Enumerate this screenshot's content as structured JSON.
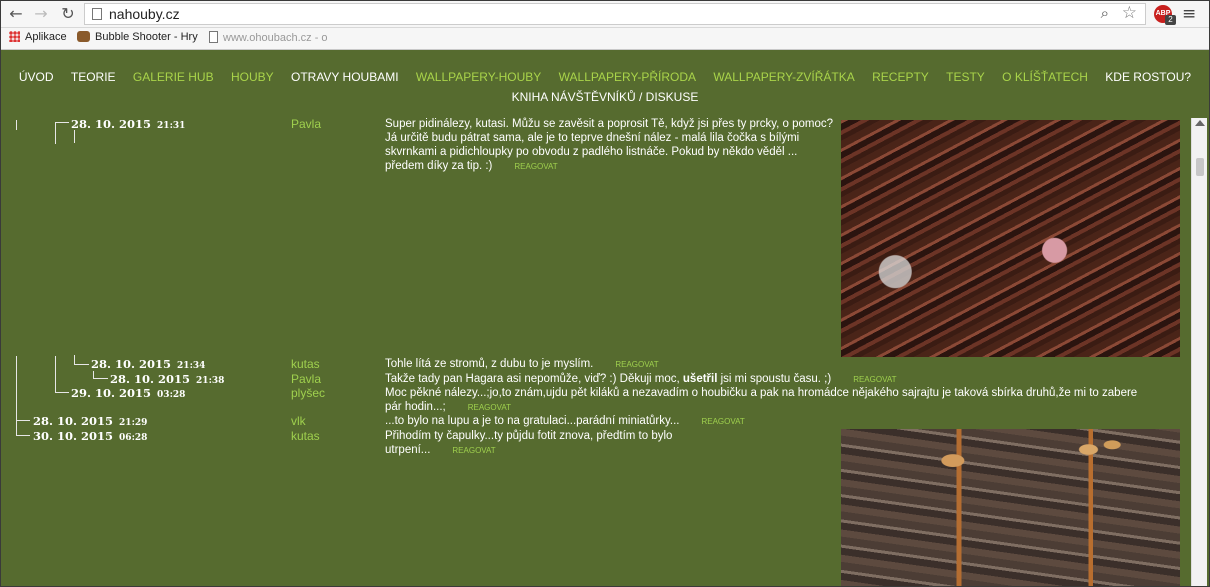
{
  "browser": {
    "url": "nahouby.cz",
    "extension_badge": "2",
    "extension_label": "ABP",
    "bookmarks": [
      {
        "label": "Aplikace",
        "icon": "apps-grid-icon"
      },
      {
        "label": "Bubble Shooter - Hry",
        "icon": "game-icon"
      },
      {
        "label": "www.ohoubach.cz - o",
        "icon": "page-icon"
      }
    ]
  },
  "nav": {
    "items": [
      {
        "label": "ÚVOD",
        "style": "light"
      },
      {
        "label": "TEORIE",
        "style": "light"
      },
      {
        "label": "GALERIE HUB",
        "style": "green"
      },
      {
        "label": "HOUBY",
        "style": "green"
      },
      {
        "label": "OTRAVY HOUBAMI",
        "style": "light"
      },
      {
        "label": "WALLPAPERY-HOUBY",
        "style": "green"
      },
      {
        "label": "WALLPAPERY-PŘÍRODA",
        "style": "green"
      },
      {
        "label": "WALLPAPERY-ZVÍŘÁTKA",
        "style": "green"
      },
      {
        "label": "RECEPTY",
        "style": "green"
      },
      {
        "label": "TESTY",
        "style": "green"
      },
      {
        "label": "O KLÍŠŤATECH",
        "style": "green"
      },
      {
        "label": "KDE ROSTOU?",
        "style": "light"
      }
    ],
    "second_row": "KNIHA NÁVŠTĚVNÍKŮ / DISKUSE"
  },
  "posts": [
    {
      "date": "28. 10. 2015",
      "time": "21:31",
      "author": "Pavla",
      "message": "Super pidinálezy, kutasi. Můžu se zavěsit a poprosit Tě, když jsi přes ty prcky, o pomoc? Já určitě budu pátrat sama, ale je to teprve dnešní nález - malá lila čočka s bílými skvrnkami a pidichloupky po obvodu z padlého listnáče. Pokud by někdo věděl ... předem díky za tip. :)"
    },
    {
      "date": "28. 10. 2015",
      "time": "21:34",
      "author": "kutas",
      "message": "Tohle lítá ze stromů, z dubu to je myslím."
    },
    {
      "date": "28. 10. 2015",
      "time": "21:38",
      "author": "Pavla",
      "message_before": "Takže tady pan Hagara asi nepomůže, viď? :) Děkuji moc, ",
      "message_bold": "ušetřil",
      "message_after": " jsi mi spoustu času. ;)"
    },
    {
      "date": "29. 10. 2015",
      "time": "03:28",
      "author": "plyšec",
      "message": "Moc pěkné nálezy...;jo,to znám,ujdu pět kiláků a nezavadím o houbičku a pak na hromádce nějakého sajrajtu je taková sbírka druhů,že mi to zabere pár hodin...;"
    },
    {
      "date": "28. 10. 2015",
      "time": "21:29",
      "author": "vlk",
      "message": "...to bylo na lupu a je to na gratulaci...parádní miniatůrky..."
    },
    {
      "date": "30. 10. 2015",
      "time": "06:28",
      "author": "kutas",
      "message": "Přihodím ty čapulky...ty půjdu fotit znova, předtím to bylo utrpení..."
    }
  ],
  "reply_label": "REAGOVAT",
  "colors": {
    "page_background": "#566b2f",
    "accent_green": "#9fd04e",
    "text": "#ffffff"
  }
}
